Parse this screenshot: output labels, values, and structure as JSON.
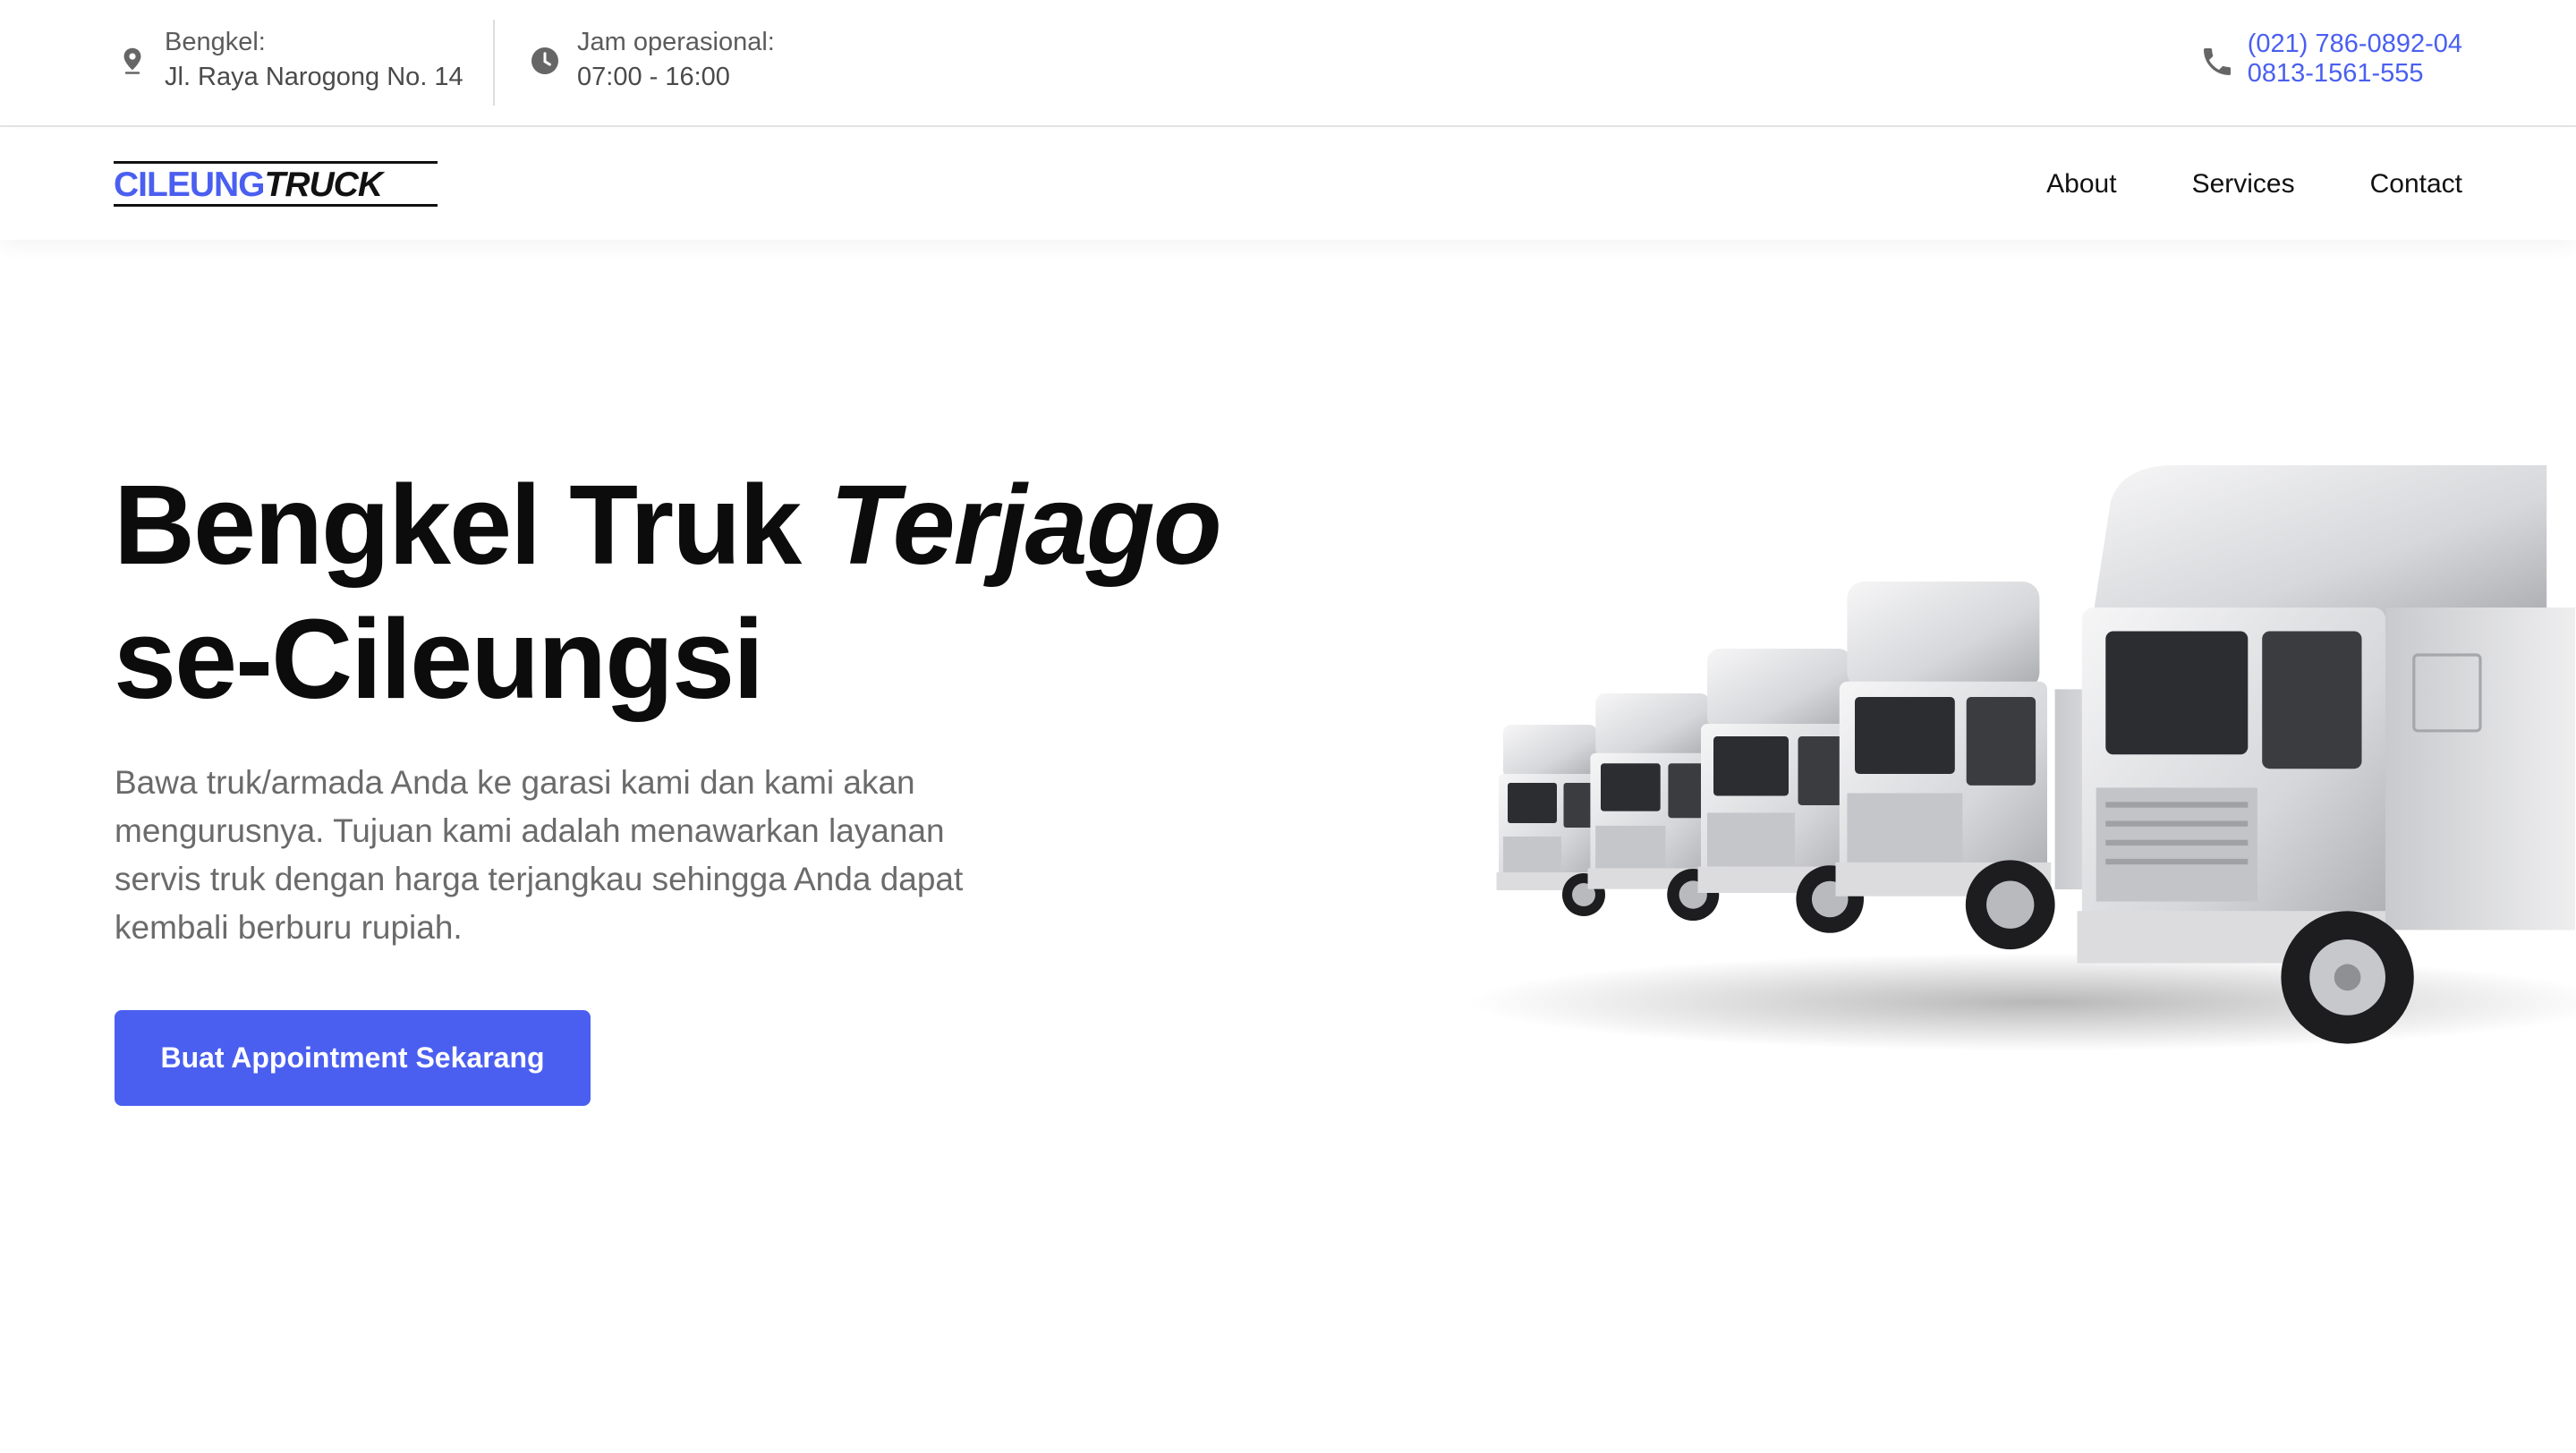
{
  "topbar": {
    "workshop": {
      "label": "Bengkel:",
      "value": "Jl. Raya Narogong No. 14",
      "icon": "map-pin-icon"
    },
    "hours": {
      "label": "Jam operasional:",
      "value": "07:00 - 16:00",
      "icon": "clock-icon"
    },
    "phones": {
      "icon": "phone-icon",
      "numbers": [
        "(021) 786-0892-04",
        "0813-1561-555"
      ]
    }
  },
  "brand": {
    "part1": "CILEUNG",
    "part2": "TRUCK"
  },
  "nav": {
    "items": [
      {
        "label": "About"
      },
      {
        "label": "Services"
      },
      {
        "label": "Contact"
      }
    ]
  },
  "hero": {
    "title_prefix": "Bengkel Truk ",
    "title_emphasis": "Terjago",
    "title_line2": "se-Cileungsi",
    "description": "Bawa truk/armada Anda ke garasi kami dan kami akan mengurusnya. Tujuan kami adalah menawarkan layanan servis truk dengan harga terjangkau sehingga Anda dapat kembali berburu rupiah.",
    "cta_label": "Buat Appointment Sekarang",
    "image": "white-trucks-fleet-image"
  },
  "colors": {
    "accent": "#4a5ff0",
    "text": "#0c0c0c",
    "muted": "#6b6b6b"
  }
}
